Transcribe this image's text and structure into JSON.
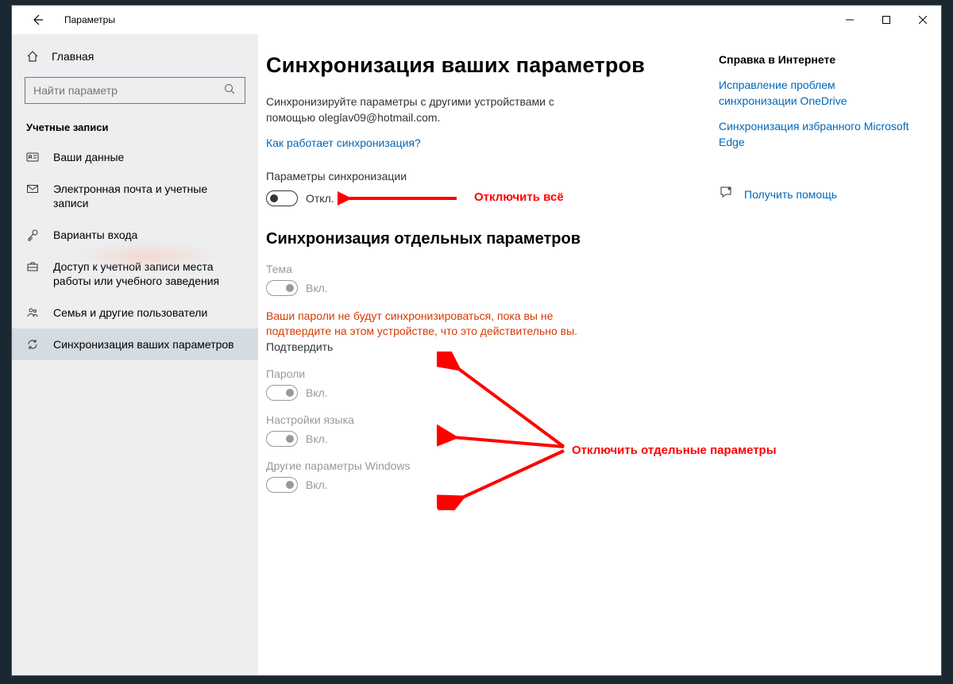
{
  "app_title": "Параметры",
  "window_controls": {
    "minimize": "—",
    "maximize": "▢",
    "close": "✕"
  },
  "sidebar": {
    "home": "Главная",
    "search_placeholder": "Найти параметр",
    "section": "Учетные записи",
    "items": [
      {
        "label": "Ваши данные",
        "icon": "user-card-icon"
      },
      {
        "label": "Электронная почта и учетные записи",
        "icon": "mail-icon"
      },
      {
        "label": "Варианты входа",
        "icon": "key-icon"
      },
      {
        "label": "Доступ к учетной записи места работы или учебного заведения",
        "icon": "briefcase-icon"
      },
      {
        "label": "Семья и другие пользователи",
        "icon": "people-icon"
      },
      {
        "label": "Синхронизация ваших параметров",
        "icon": "sync-icon"
      }
    ]
  },
  "main": {
    "title": "Синхронизация ваших параметров",
    "desc": "Синхронизируйте параметры с другими устройствами с помощью oleglav09@hotmail.com.",
    "how_link": "Как работает синхронизация?",
    "sync_params_label": "Параметры синхронизации",
    "main_toggle_state": "Откл.",
    "section2": "Синхронизация отдельных параметров",
    "items": [
      {
        "label": "Тема",
        "state": "Вкл."
      },
      {
        "label": "Пароли",
        "state": "Вкл."
      },
      {
        "label": "Настройки языка",
        "state": "Вкл."
      },
      {
        "label": "Другие параметры Windows",
        "state": "Вкл."
      }
    ],
    "warning": "Ваши пароли не будут синхронизироваться, пока вы не подтвердите на этом устройстве, что это действительно вы.",
    "confirm": "Подтвердить"
  },
  "side": {
    "heading": "Справка в Интернете",
    "links": [
      "Исправление проблем синхронизации OneDrive",
      "Синхронизация избранного Microsoft Edge"
    ],
    "help": "Получить помощь"
  },
  "annotations": {
    "all_off": "Отключить всё",
    "individual_off": "Отключить отдельные параметры"
  }
}
